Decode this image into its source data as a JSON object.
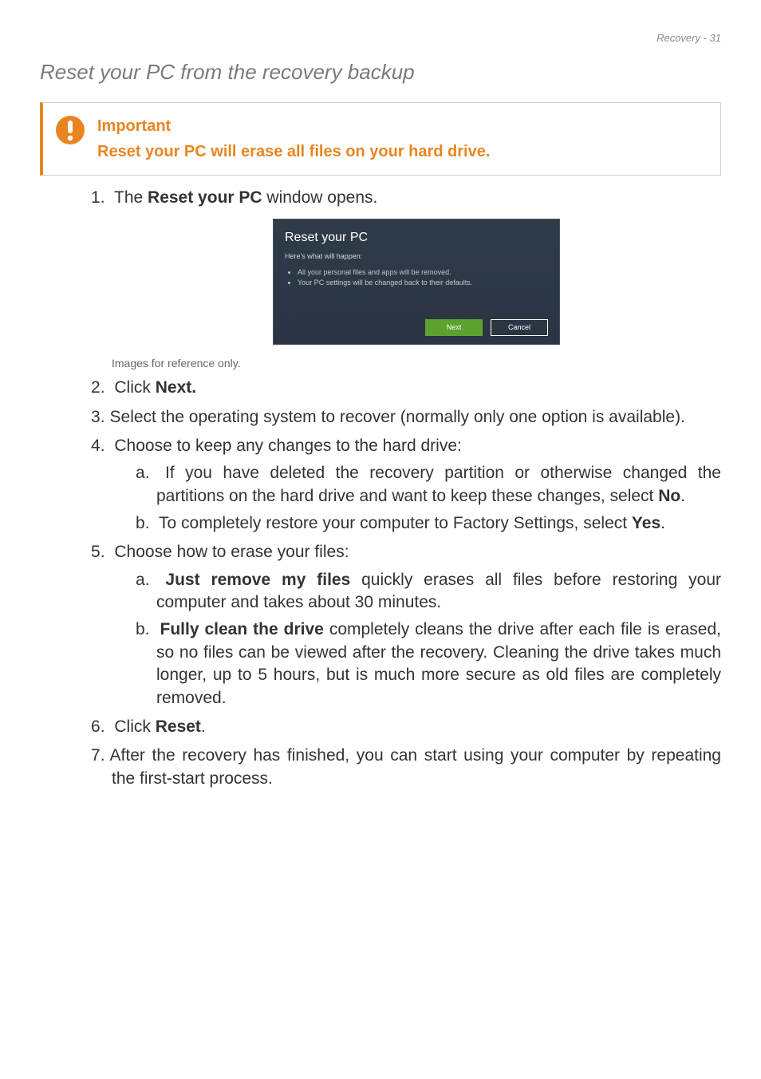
{
  "header": {
    "text": "Recovery - 31"
  },
  "title": "Reset your PC from the recovery backup",
  "important": {
    "heading": "Important",
    "body": "Reset your PC will erase all files on your hard drive."
  },
  "screenshot": {
    "title": "Reset your PC",
    "subtitle": "Here's what will happen:",
    "bullets": [
      "All your personal files and apps will be removed.",
      "Your PC settings will be changed back to their defaults."
    ],
    "next": "Next",
    "cancel": "Cancel"
  },
  "reference": "Images for reference only.",
  "steps": {
    "s1_pre": "The ",
    "s1_bold": "Reset your PC",
    "s1_post": " window opens.",
    "s2_pre": "Click ",
    "s2_bold": "Next.",
    "s3": "Select the operating system to recover (normally only one option is available).",
    "s4": "Choose to keep any changes to the hard drive:",
    "s4a_pre": "If you have deleted the recovery partition or otherwise changed the partitions on the hard drive and want to keep these changes, select ",
    "s4a_bold": "No",
    "s4a_post": ".",
    "s4b_pre": "To completely restore your computer to Factory Settings, select ",
    "s4b_bold": "Yes",
    "s4b_post": ".",
    "s5": "Choose how to erase your files:",
    "s5a_bold": "Just remove my files",
    "s5a_post": " quickly erases all files before restoring your computer and takes about 30 minutes.",
    "s5b_bold": "Fully clean the drive",
    "s5b_post": " completely cleans the drive after each file is erased, so no files can be viewed after the recovery. Cleaning the drive takes much longer, up to 5 hours, but is much more secure as old files are completely removed.",
    "s6_pre": "Click ",
    "s6_bold": "Reset",
    "s6_post": ".",
    "s7": "After the recovery has finished, you can start using your computer by repeating the first-start process."
  }
}
